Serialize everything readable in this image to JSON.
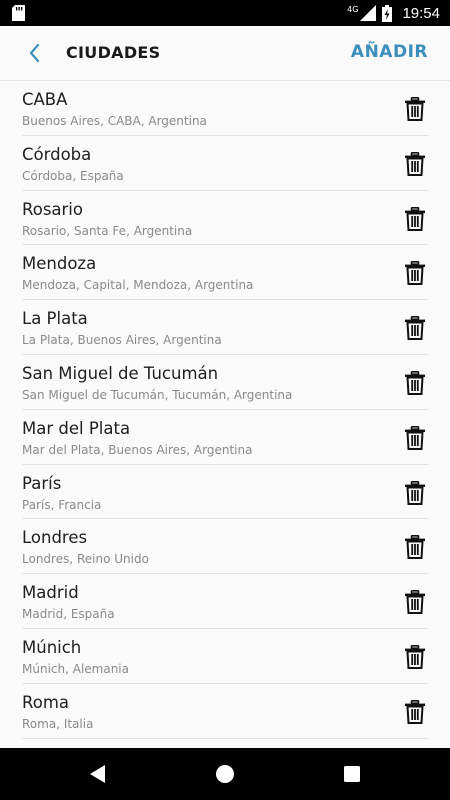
{
  "status_bar": {
    "time": "19:54",
    "network": "4G",
    "icons": [
      "sd-card-icon",
      "signal-icon",
      "battery-charging-icon"
    ]
  },
  "toolbar": {
    "back_icon": "chevron-left-icon",
    "title": "CIUDADES",
    "add_label": "AÑADIR",
    "accent_color": "#3a8fbd"
  },
  "cities": [
    {
      "name": "CABA",
      "detail": "Buenos Aires, CABA, Argentina"
    },
    {
      "name": "Córdoba",
      "detail": "Córdoba, España"
    },
    {
      "name": "Rosario",
      "detail": "Rosario, Santa Fe, Argentina"
    },
    {
      "name": "Mendoza",
      "detail": "Mendoza, Capital, Mendoza, Argentina"
    },
    {
      "name": "La Plata",
      "detail": "La Plata, Buenos Aires, Argentina"
    },
    {
      "name": "San Miguel de Tucumán",
      "detail": "San Miguel de Tucumán, Tucumán, Argentina"
    },
    {
      "name": "Mar del Plata",
      "detail": "Mar del Plata, Buenos Aires, Argentina"
    },
    {
      "name": "París",
      "detail": "París, Francia"
    },
    {
      "name": "Londres",
      "detail": "Londres, Reino Unido"
    },
    {
      "name": "Madrid",
      "detail": "Madrid, España"
    },
    {
      "name": "Múnich",
      "detail": "Múnich, Alemania"
    },
    {
      "name": "Roma",
      "detail": "Roma, Italia"
    }
  ],
  "nav_bar": {
    "icons": [
      "back-triangle-icon",
      "home-circle-icon",
      "recents-square-icon"
    ]
  }
}
